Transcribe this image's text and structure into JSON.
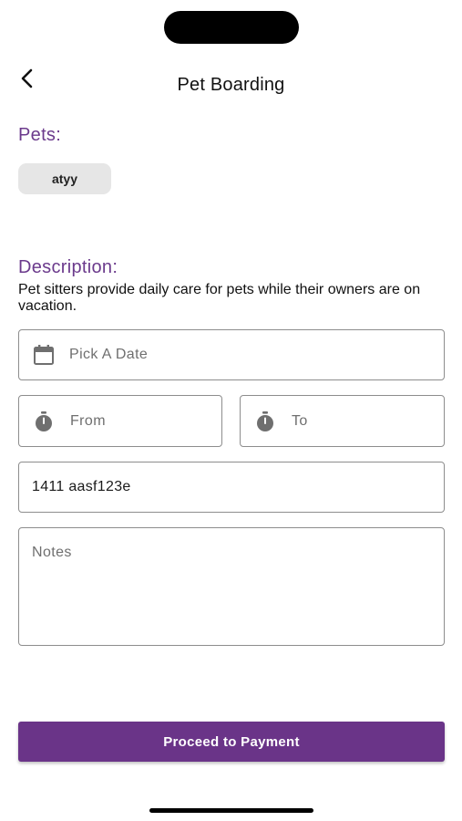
{
  "header": {
    "title": "Pet Boarding",
    "back_icon": "chevron-left-icon"
  },
  "pets": {
    "label": "Pets:",
    "chips": [
      "atyy"
    ]
  },
  "description": {
    "label": "Description:",
    "text": "Pet sitters provide daily care for pets while their owners are on vacation."
  },
  "form": {
    "date": {
      "placeholder": "Pick A Date",
      "icon": "calendar-icon",
      "value": ""
    },
    "from": {
      "placeholder": "From",
      "icon": "timer-icon",
      "value": ""
    },
    "to": {
      "placeholder": "To",
      "icon": "timer-icon",
      "value": ""
    },
    "address": {
      "value": "1411 aasf123e"
    },
    "notes": {
      "placeholder": "Notes",
      "value": ""
    }
  },
  "actions": {
    "proceed_label": "Proceed to Payment"
  },
  "colors": {
    "accent": "#6a3488",
    "section_label": "#6b3a8c",
    "chip_bg": "#e6e6e6",
    "field_border": "#8d8d8d"
  }
}
